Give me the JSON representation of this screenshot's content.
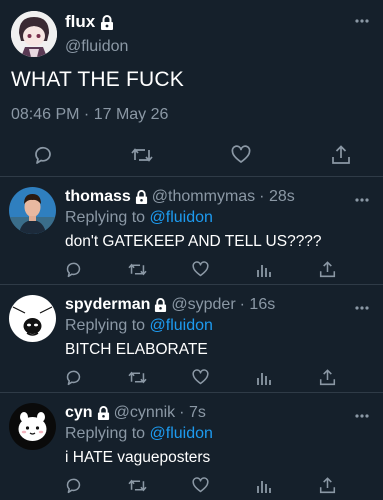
{
  "main_post": {
    "name": "flux",
    "handle": "@fluidon",
    "text": "WHAT THE FUCK",
    "timestamp": "08:46 PM · 17 May 26"
  },
  "replies": [
    {
      "name": "thomass",
      "handle": "@thommymas",
      "time": "· 28s",
      "replying_prefix": "Replying to",
      "replying_to": "@fluidon",
      "text": "don't GATEKEEP AND TELL US????"
    },
    {
      "name": "spyderman",
      "handle": "@sypder",
      "time": "· 16s",
      "replying_prefix": "Replying to",
      "replying_to": "@fluidon",
      "text": "BITCH ELABORATE"
    },
    {
      "name": "cyn",
      "handle": "@cynnik",
      "time": "· 7s",
      "replying_prefix": "Replying to",
      "replying_to": "@fluidon",
      "text": "i HATE vagueposters"
    }
  ],
  "colors": {
    "background": "#15202b",
    "text": "#ffffff",
    "muted": "#8b98a5",
    "accent": "#1d9bf0",
    "divider": "#2f3b47"
  },
  "icons": [
    "lock-icon",
    "more-icon",
    "reply-icon",
    "retweet-icon",
    "like-icon",
    "analytics-icon",
    "share-icon"
  ]
}
